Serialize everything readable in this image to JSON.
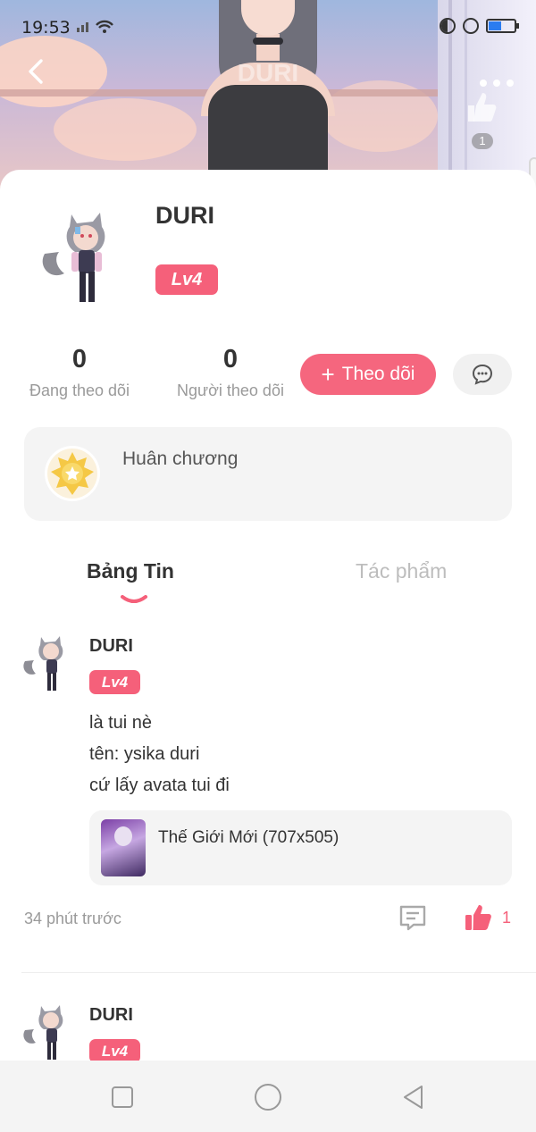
{
  "status_bar": {
    "time": "19:53"
  },
  "banner": {
    "title": "DURI",
    "like_count": "1"
  },
  "profile": {
    "name": "DURI",
    "level": "Lv4",
    "stats": [
      {
        "value": "0",
        "label": "Đang theo dõi"
      },
      {
        "value": "0",
        "label": "Người theo dõi"
      }
    ],
    "follow_label": "Theo dõi",
    "medal_label": "Huân chương"
  },
  "tabs": [
    {
      "label": "Bảng Tin",
      "active": true
    },
    {
      "label": "Tác phẩm",
      "active": false
    }
  ],
  "posts": [
    {
      "author": "DURI",
      "level": "Lv4",
      "lines": [
        "là tui nè",
        "tên: ysika duri",
        "cứ lấy avata tui đi"
      ],
      "attachment": "Thế Giới Mới (707x505)",
      "time": "34 phút trước",
      "likes": "1"
    },
    {
      "author": "DURI",
      "level": "Lv4"
    }
  ],
  "colors": {
    "accent": "#f5607a",
    "muted": "#9a9a9a",
    "card_bg": "#f4f4f4"
  }
}
